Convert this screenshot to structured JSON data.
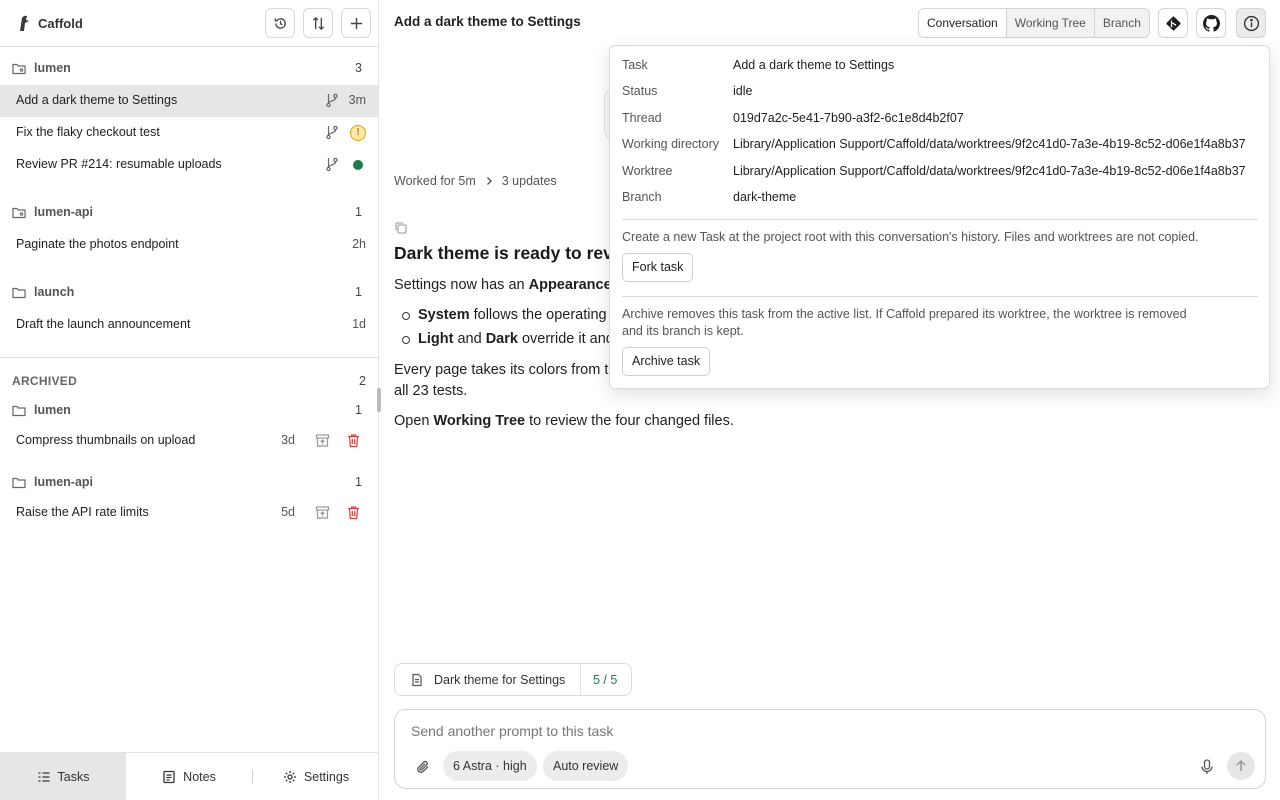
{
  "app": {
    "name": "Caffold"
  },
  "sidebar": {
    "projects": [
      {
        "name": "lumen",
        "count": "3"
      },
      {
        "name": "lumen-api",
        "count": "1"
      },
      {
        "name": "launch",
        "count": "1"
      }
    ],
    "tasks": [
      {
        "title": "Add a dark theme to Settings",
        "age": "3m"
      },
      {
        "title": "Fix the flaky checkout test",
        "status": "!"
      },
      {
        "title": "Review PR #214: resumable uploads"
      },
      {
        "title": "Paginate the photos endpoint",
        "age": "2h"
      },
      {
        "title": "Draft the launch announcement",
        "age": "1d"
      }
    ],
    "archived": {
      "title": "ARCHIVED",
      "count": "2",
      "groups": [
        {
          "name": "lumen",
          "count": "1",
          "task": "Compress thumbnails on upload",
          "age": "3d"
        },
        {
          "name": "lumen-api",
          "count": "1",
          "task": "Raise the API rate limits",
          "age": "5d"
        }
      ]
    },
    "nav": {
      "tasks": "Tasks",
      "notes": "Notes",
      "settings": "Settings"
    }
  },
  "main": {
    "title": "Add a dark theme to Settings",
    "tabs": [
      "Conversation",
      "Working Tree",
      "Branch"
    ],
    "worked": {
      "duration": "Worked for 5m",
      "updates": "3 updates"
    },
    "answer": {
      "heading": "Dark theme is ready to revi",
      "p1_a": "Settings now has an ",
      "p1_b": "Appearance",
      "b1_bold": "System",
      "b1_text": " follows the operating",
      "b2_bold1": "Light",
      "b2_mid": " and ",
      "b2_bold2": "Dark",
      "b2_text": " override it and",
      "p2_line1": "Every page takes its colors from t",
      "p2_line2": "all 23 tests.",
      "p3_a": "Open ",
      "p3_b": "Working Tree",
      "p3_c": " to review the four changed files."
    },
    "plan": {
      "title": "Dark theme for Settings",
      "progress": "5 / 5"
    },
    "composer": {
      "placeholder": "Send another prompt to this task",
      "model": "6 Astra · high",
      "review": "Auto review"
    }
  },
  "info": {
    "rows": [
      {
        "key": "Task",
        "value": "Add a dark theme to Settings"
      },
      {
        "key": "Status",
        "value": "idle"
      },
      {
        "key": "Thread",
        "value": "019d7a2c-5e41-7b90-a3f2-6c1e8d4b2f07"
      },
      {
        "key": "Working directory",
        "value": "Library/Application Support/Caffold/data/worktrees/9f2c41d0-7a3e-4b19-8c52-d06e1f4a8b37"
      },
      {
        "key": "Worktree",
        "value": "Library/Application Support/Caffold/data/worktrees/9f2c41d0-7a3e-4b19-8c52-d06e1f4a8b37"
      },
      {
        "key": "Branch",
        "value": "dark-theme"
      }
    ],
    "fork_text": "Create a new Task at the project root with this conversation's history. Files and worktrees are not copied.",
    "fork_button": "Fork task",
    "archive_text": "Archive removes this task from the active list. If Caffold prepared its worktree, the worktree is removed and its branch is kept.",
    "archive_button": "Archive task"
  },
  "colors": {
    "accent_green": "#1e7a4c",
    "warning": "#d8a315",
    "delete_red": "#d64545"
  },
  "icons": [
    "history-icon",
    "sort-icon",
    "plus-icon",
    "folder-icon",
    "branch-icon",
    "warning-icon",
    "git-icon",
    "github-icon",
    "info-icon",
    "copy-icon",
    "chevron-right-icon",
    "document-icon",
    "paperclip-icon",
    "mic-icon",
    "send-icon",
    "tasks-icon",
    "notes-icon",
    "settings-icon",
    "unarchive-icon",
    "trash-icon"
  ]
}
